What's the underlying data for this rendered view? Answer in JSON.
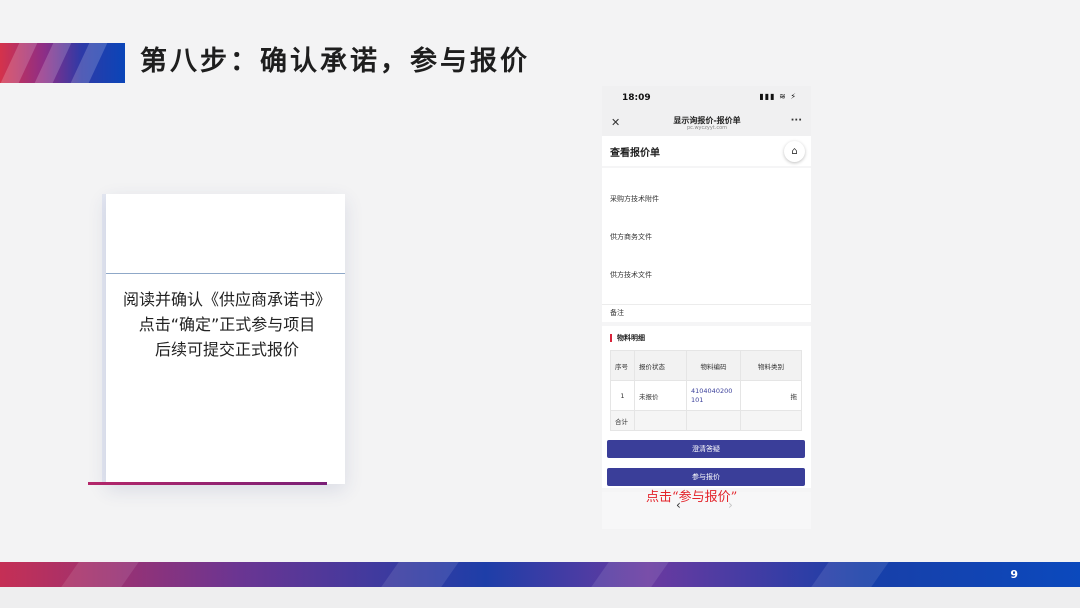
{
  "slide": {
    "title": "第八步：确认承诺，参与报价",
    "page_number": "9"
  },
  "card": {
    "lines": [
      "阅读并确认《供应商承诺书》",
      "点击“确定”正式参与项目",
      "后续可提交正式报价"
    ]
  },
  "phone": {
    "status": {
      "time": "18:09",
      "icons": "▮▮▮ ≋ ⚡"
    },
    "nav": {
      "close": "✕",
      "title": "显示询报价-报价单",
      "url": "pc.wyczyyt.com",
      "more": "···"
    },
    "header": {
      "title": "查看报价单",
      "home_icon": "⌂"
    },
    "info_rows": [
      "采购方技术附件",
      "供方商务文件",
      "供方技术文件",
      "备注"
    ],
    "materials": {
      "title": "物料明细",
      "columns": [
        "序号",
        "报价状态",
        "物料编码",
        "物料类别"
      ],
      "rows": [
        {
          "index": "1",
          "status": "未报价",
          "code": "4104040200101",
          "category": "拖"
        }
      ],
      "total_label": "合计"
    },
    "buttons": {
      "clarify": "澄清答疑",
      "participate": "参与报价"
    },
    "bottom": {
      "back": "‹",
      "forward": "›"
    }
  },
  "annotation": "点击“参与报价”",
  "colors": {
    "accent_red": "#e3242b",
    "button_blue": "#3a3e99"
  }
}
